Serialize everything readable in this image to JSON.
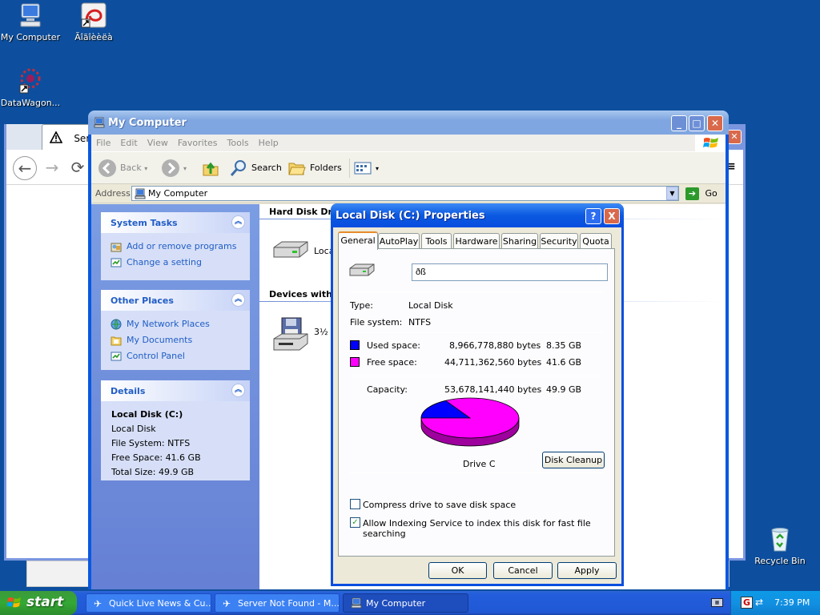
{
  "desktop": {
    "icons": [
      {
        "label": "My Computer",
        "icon": "computer-icon"
      },
      {
        "label": "Ãîãîèèëà",
        "icon": "shortcut-app-icon"
      },
      {
        "label": "DataWagon...",
        "icon": "datawagon-icon"
      },
      {
        "label": "Recycle Bin",
        "icon": "recycle-bin-icon"
      }
    ]
  },
  "browser": {
    "tab_label": "Server",
    "warning_icon": "warning-icon",
    "nav": {
      "back": "←",
      "forward": "→",
      "reload": "⟳"
    }
  },
  "my_computer": {
    "title": "My Computer",
    "menu": [
      "File",
      "Edit",
      "View",
      "Favorites",
      "Tools",
      "Help"
    ],
    "toolbar": {
      "back": "Back",
      "search": "Search",
      "folders": "Folders"
    },
    "address": {
      "label": "Address",
      "value": "My Computer",
      "go": "Go"
    },
    "system_tasks": {
      "title": "System Tasks",
      "items": [
        "Add or remove programs",
        "Change a setting"
      ]
    },
    "other_places": {
      "title": "Other Places",
      "items": [
        "My Network Places",
        "My Documents",
        "Control Panel"
      ]
    },
    "details": {
      "title": "Details",
      "name": "Local Disk (C:)",
      "type": "Local Disk",
      "file_system": "File System: NTFS",
      "free_space": "Free Space: 41.6 GB",
      "total_size": "Total Size: 49.9 GB"
    },
    "sections": {
      "hard_disk": "Hard Disk Driv",
      "hard_disk_item": "Loca",
      "removable": "Devices with R",
      "removable_item": "3½"
    }
  },
  "properties": {
    "title": "Local Disk (C:) Properties",
    "help_btn": "?",
    "close_btn": "X",
    "tabs": [
      "General",
      "AutoPlay",
      "Tools",
      "Hardware",
      "Sharing",
      "Security",
      "Quota"
    ],
    "active_tab": "General",
    "volume_label": "ðß",
    "type_label": "Type:",
    "type_value": "Local Disk",
    "fs_label": "File system:",
    "fs_value": "NTFS",
    "used_label": "Used space:",
    "used_bytes": "8,966,778,880 bytes",
    "used_gb": "8.35 GB",
    "free_label": "Free space:",
    "free_bytes": "44,711,362,560 bytes",
    "free_gb": "41.6 GB",
    "capacity_label": "Capacity:",
    "capacity_bytes": "53,678,141,440 bytes",
    "capacity_gb": "49.9 GB",
    "drive_caption": "Drive C",
    "disk_cleanup": "Disk Cleanup",
    "compress_label": "Compress drive to save disk space",
    "compress_checked": false,
    "index_label": "Allow Indexing Service to index this disk for fast file searching",
    "index_checked": true,
    "ok": "OK",
    "cancel": "Cancel",
    "apply": "Apply",
    "used_fraction": 0.167,
    "colors": {
      "used": "#0000ff",
      "free": "#ff00ff"
    }
  },
  "taskbar": {
    "start": "start",
    "tasks": [
      {
        "label": "Quick Live News & Cu...",
        "active": false
      },
      {
        "label": "Server Not Found - M...",
        "active": false
      },
      {
        "label": "My Computer",
        "active": true
      }
    ],
    "clock": "7:39 PM"
  }
}
